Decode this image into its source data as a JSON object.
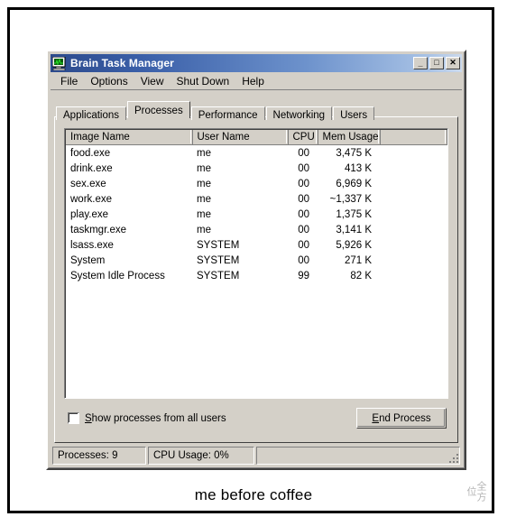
{
  "window": {
    "title": "Brain Task Manager",
    "icon": "monitor-icon",
    "buttons": {
      "minimize": "_",
      "maximize": "□",
      "close": "✕"
    }
  },
  "menu": {
    "items": [
      {
        "label": "File"
      },
      {
        "label": "Options"
      },
      {
        "label": "View"
      },
      {
        "label": "Shut Down"
      },
      {
        "label": "Help"
      }
    ]
  },
  "tabs": [
    {
      "label": "Applications",
      "active": false
    },
    {
      "label": "Processes",
      "active": true
    },
    {
      "label": "Performance",
      "active": false
    },
    {
      "label": "Networking",
      "active": false
    },
    {
      "label": "Users",
      "active": false
    }
  ],
  "process_table": {
    "columns": [
      "Image Name",
      "User Name",
      "CPU",
      "Mem Usage",
      ""
    ],
    "rows": [
      {
        "image_name": "food.exe",
        "user_name": "me",
        "cpu": "00",
        "mem_usage": "3,475 K"
      },
      {
        "image_name": "drink.exe",
        "user_name": "me",
        "cpu": "00",
        "mem_usage": "413 K"
      },
      {
        "image_name": "sex.exe",
        "user_name": "me",
        "cpu": "00",
        "mem_usage": "6,969 K"
      },
      {
        "image_name": "work.exe",
        "user_name": "me",
        "cpu": "00",
        "mem_usage": "~1,337 K"
      },
      {
        "image_name": "play.exe",
        "user_name": "me",
        "cpu": "00",
        "mem_usage": "1,375 K"
      },
      {
        "image_name": "taskmgr.exe",
        "user_name": "me",
        "cpu": "00",
        "mem_usage": "3,141 K"
      },
      {
        "image_name": "lsass.exe",
        "user_name": "SYSTEM",
        "cpu": "00",
        "mem_usage": "5,926 K"
      },
      {
        "image_name": "System",
        "user_name": "SYSTEM",
        "cpu": "00",
        "mem_usage": "271 K"
      },
      {
        "image_name": "System Idle Process",
        "user_name": "SYSTEM",
        "cpu": "99",
        "mem_usage": "82 K"
      }
    ]
  },
  "controls": {
    "show_all_users_label_prefix": "",
    "show_all_users_accel": "S",
    "show_all_users_label_rest": "how processes from all users",
    "show_all_users_checked": false,
    "end_process_accel": "E",
    "end_process_label_rest": "nd Process"
  },
  "statusbar": {
    "processes": "Processes: 9",
    "cpu_usage": "CPU Usage: 0%",
    "extra": ""
  },
  "caption": "me before coffee",
  "watermark": "全方位",
  "colors": {
    "face": "#d4d0c8",
    "title_gradient_start": "#2c4a8c",
    "title_gradient_end": "#cbd9ec",
    "window_bg": "#ffffff",
    "frame": "#000000"
  }
}
